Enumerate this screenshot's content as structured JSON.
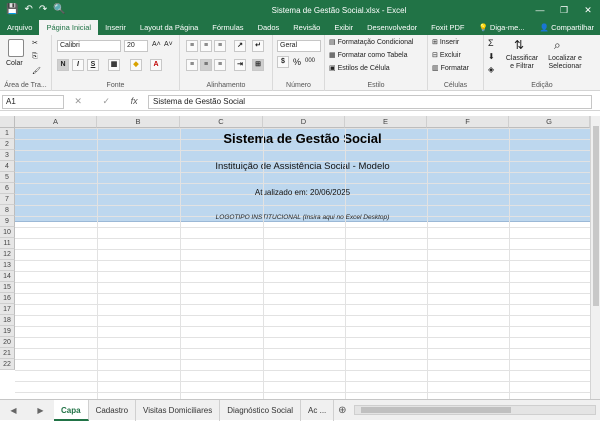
{
  "window": {
    "title": "Sistema de Gestão Social.xlsx - Excel",
    "controls": [
      "—",
      "❐",
      "✕"
    ]
  },
  "qat": {
    "save": "💾",
    "undo": "↶",
    "redo": "↷",
    "preview": "🔍"
  },
  "tabs": [
    {
      "label": "Arquivo",
      "active": false
    },
    {
      "label": "Página Inicial",
      "active": true
    },
    {
      "label": "Inserir",
      "active": false
    },
    {
      "label": "Layout da Página",
      "active": false
    },
    {
      "label": "Fórmulas",
      "active": false
    },
    {
      "label": "Dados",
      "active": false
    },
    {
      "label": "Revisão",
      "active": false
    },
    {
      "label": "Exibir",
      "active": false
    },
    {
      "label": "Desenvolvedor",
      "active": false
    },
    {
      "label": "Foxit PDF",
      "active": false
    },
    {
      "label": "💡 Diga-me...",
      "active": false
    }
  ],
  "share_label": "Compartilhar",
  "ribbon": {
    "paste": "Colar",
    "clipboard": "Área de Tra...",
    "font_name": "Calibri",
    "font_size": "20",
    "grow": "A˄",
    "shrink": "A˅",
    "bold": "N",
    "italic": "I",
    "underline": "S",
    "font_group": "Fonte",
    "align_group": "Alinhamento",
    "number_format": "Geral",
    "percent": "%",
    "comma": "000",
    "number_group": "Número",
    "cond_format": "Formatação Condicional",
    "table_format": "Formatar como Tabela",
    "cell_styles": "Estilos de Célula",
    "styles_group": "Estilo",
    "insert": "Inserir",
    "delete": "Excluir",
    "format": "Formatar",
    "cells_group": "Células",
    "sort": "Classificar e Filtrar",
    "find": "Localizar e Selecionar",
    "edit_group": "Edição"
  },
  "formula_bar": {
    "name_box": "A1",
    "cancel": "✕",
    "enter": "✓",
    "fx": "fx",
    "value": "Sistema de Gestão Social"
  },
  "columns": [
    "A",
    "B",
    "C",
    "D",
    "E",
    "F",
    "G"
  ],
  "rows": [
    "1",
    "2",
    "3",
    "4",
    "5",
    "6",
    "7",
    "8",
    "9",
    "10",
    "11",
    "12",
    "13",
    "14",
    "15",
    "16",
    "17",
    "18",
    "19",
    "20",
    "21",
    "22"
  ],
  "cells": {
    "title": "Sistema de Gestão Social",
    "institution": "Instituição de Assistência Social - Modelo",
    "updated": "Atualizado em: 20/06/2025",
    "logo": "LOGOTIPO INSTITUCIONAL (Insira aqui no Excel Desktop)"
  },
  "band_color": "#bdd7ee",
  "accent": "#217346",
  "sheets": [
    {
      "label": "Capa",
      "active": true
    },
    {
      "label": "Cadastro",
      "active": false
    },
    {
      "label": "Visitas Domiciliares",
      "active": false
    },
    {
      "label": "Diagnóstico Social",
      "active": false
    },
    {
      "label": "Ac ...",
      "active": false
    }
  ]
}
